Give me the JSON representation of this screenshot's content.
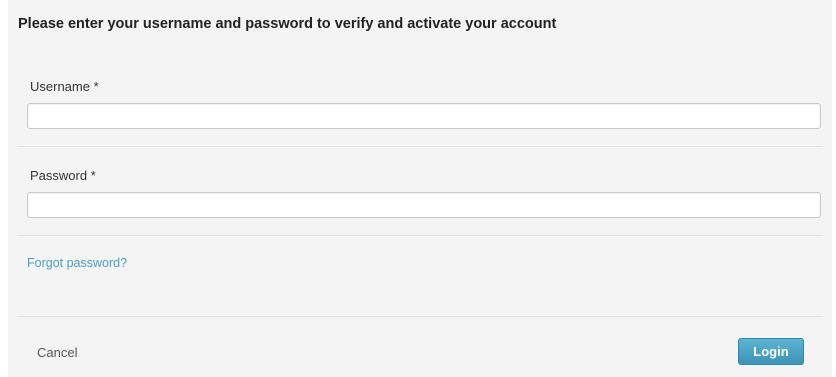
{
  "form": {
    "title": "Please enter your username and password to verify and activate your account",
    "username": {
      "label": "Username *",
      "value": "",
      "placeholder": ""
    },
    "password": {
      "label": "Password *",
      "value": "",
      "placeholder": ""
    },
    "forgot_link": "Forgot password?",
    "cancel_label": "Cancel",
    "login_label": "Login"
  },
  "colors": {
    "panel_background": "#f4f4f4",
    "link": "#4a9fc7",
    "login_button": "#4aa3c4"
  }
}
